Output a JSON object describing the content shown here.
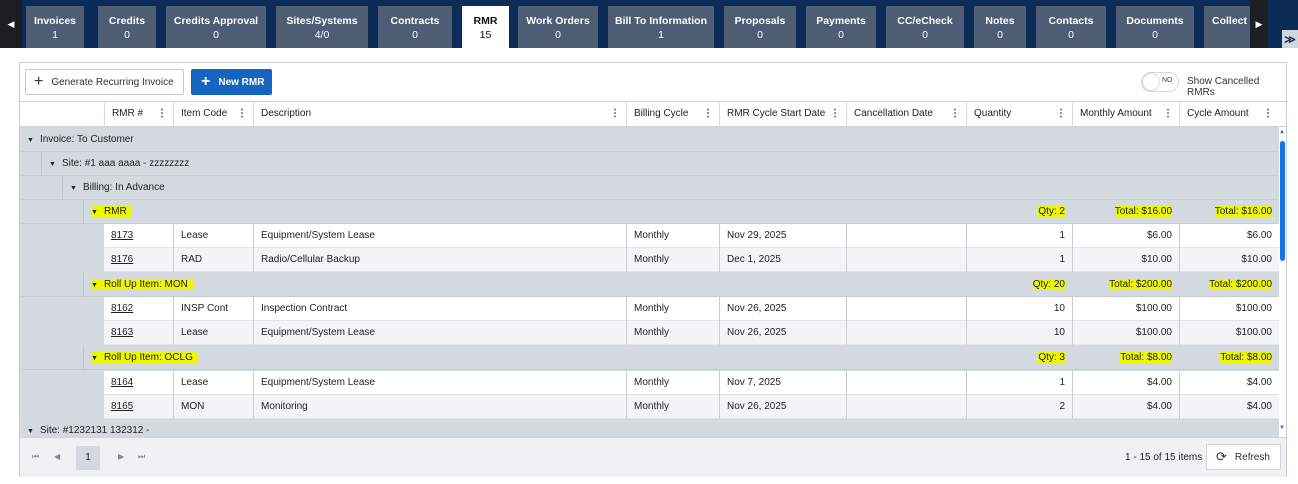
{
  "tabs": [
    {
      "label": "Invoices",
      "count": "1"
    },
    {
      "label": "Credits",
      "count": "0"
    },
    {
      "label": "Credits Approval",
      "count": "0"
    },
    {
      "label": "Sites/Systems",
      "count": "4/0"
    },
    {
      "label": "Contracts",
      "count": "0"
    },
    {
      "label": "RMR",
      "count": "15"
    },
    {
      "label": "Work Orders",
      "count": "0"
    },
    {
      "label": "Bill To Information",
      "count": "1"
    },
    {
      "label": "Proposals",
      "count": "0"
    },
    {
      "label": "Payments",
      "count": "0"
    },
    {
      "label": "CC/eCheck",
      "count": "0"
    },
    {
      "label": "Notes",
      "count": "0"
    },
    {
      "label": "Contacts",
      "count": "0"
    },
    {
      "label": "Documents",
      "count": "0"
    },
    {
      "label": "Collect",
      "count": ""
    }
  ],
  "toolbar": {
    "generate_label": "Generate Recurring Invoice",
    "new_label": "New RMR",
    "toggle_state": "NO",
    "toggle_label": "Show Cancelled RMRs"
  },
  "columns": {
    "rmr": "RMR #",
    "item_code": "Item Code",
    "description": "Description",
    "billing_cycle": "Billing Cycle",
    "start_date": "RMR Cycle Start Date",
    "cancel_date": "Cancellation Date",
    "quantity": "Quantity",
    "monthly": "Monthly Amount",
    "cycle": "Cycle Amount"
  },
  "groups": {
    "invoice": "Invoice: To Customer",
    "site1": "Site: #1 aaa aaaa - zzzzzzzz",
    "billing": "Billing: In Advance",
    "site2": "Site: #1232131 132312 -",
    "rmr": {
      "label": "RMR",
      "qty": "Qty: 2",
      "monthly": "Total: $16.00",
      "cycle": "Total: $16.00"
    },
    "mon": {
      "label": "Roll Up Item: MON",
      "qty": "Qty: 20",
      "monthly": "Total: $200.00",
      "cycle": "Total: $200.00"
    },
    "oclg": {
      "label": "Roll Up Item: OCLG",
      "qty": "Qty: 3",
      "monthly": "Total: $8.00",
      "cycle": "Total: $8.00"
    }
  },
  "rows": [
    {
      "rmr": "8173",
      "code": "Lease",
      "desc": "Equipment/System Lease",
      "cycle_name": "Monthly",
      "start": "Nov 29, 2025",
      "qty": "1",
      "monthly": "$6.00",
      "cycle_amt": "$6.00"
    },
    {
      "rmr": "8176",
      "code": "RAD",
      "desc": "Radio/Cellular Backup",
      "cycle_name": "Monthly",
      "start": "Dec 1, 2025",
      "qty": "1",
      "monthly": "$10.00",
      "cycle_amt": "$10.00"
    },
    {
      "rmr": "8162",
      "code": "INSP Cont",
      "desc": "Inspection Contract",
      "cycle_name": "Monthly",
      "start": "Nov 26, 2025",
      "qty": "10",
      "monthly": "$100.00",
      "cycle_amt": "$100.00"
    },
    {
      "rmr": "8163",
      "code": "Lease",
      "desc": "Equipment/System Lease",
      "cycle_name": "Monthly",
      "start": "Nov 26, 2025",
      "qty": "10",
      "monthly": "$100.00",
      "cycle_amt": "$100.00"
    },
    {
      "rmr": "8164",
      "code": "Lease",
      "desc": "Equipment/System Lease",
      "cycle_name": "Monthly",
      "start": "Nov 7, 2025",
      "qty": "1",
      "monthly": "$4.00",
      "cycle_amt": "$4.00"
    },
    {
      "rmr": "8165",
      "code": "MON",
      "desc": "Monitoring",
      "cycle_name": "Monthly",
      "start": "Nov 26, 2025",
      "qty": "2",
      "monthly": "$4.00",
      "cycle_amt": "$4.00"
    }
  ],
  "pager": {
    "page": "1",
    "info": "1 - 15 of 15 items",
    "refresh_label": "Refresh"
  },
  "colors": {
    "accent": "#1565c0",
    "tab_bg": "#4d5d73",
    "highlight": "#ecf700"
  }
}
